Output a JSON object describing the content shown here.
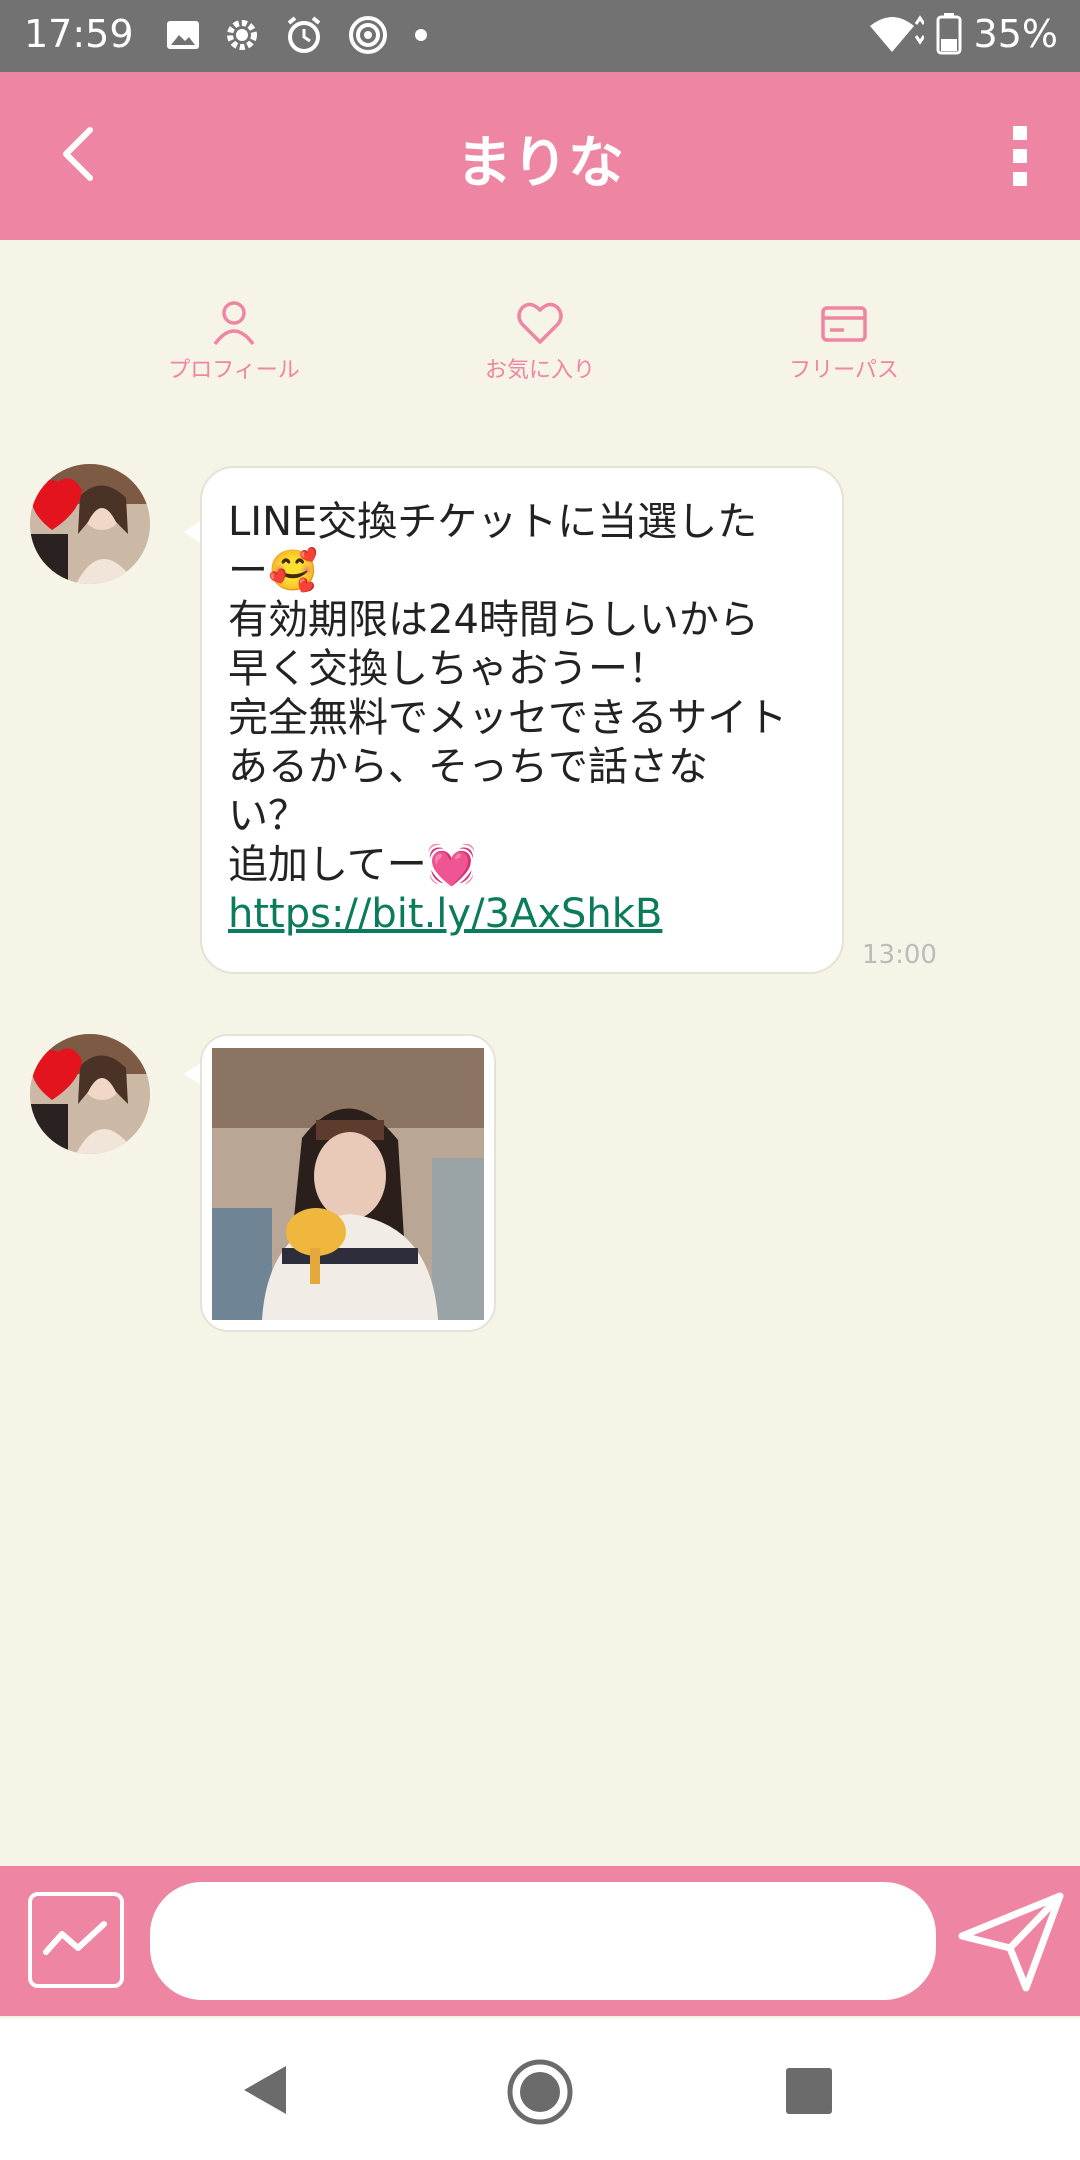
{
  "status_bar": {
    "time": "17:59",
    "battery": "35%"
  },
  "header": {
    "title": "まりな"
  },
  "actions": [
    {
      "label": "プロフィール",
      "icon": "person-icon"
    },
    {
      "label": "お気に入り",
      "icon": "heart-icon"
    },
    {
      "label": "フリーパス",
      "icon": "card-icon"
    }
  ],
  "messages": [
    {
      "lines": [
        "LINE交換チケットに当選した",
        "ー🥰",
        "有効期限は24時間らしいから",
        "早く交換しちゃおうー！",
        "完全無料でメッセできるサイト",
        "あるから、そっちで話さな",
        "い？",
        "追加してー💓"
      ],
      "link": "https://bit.ly/3AxShkB",
      "time": "13:00"
    }
  ],
  "composer": {
    "placeholder": ""
  },
  "colors": {
    "accent": "#ee85a3",
    "background": "#f6f3e7",
    "link": "#0a7c5c"
  }
}
